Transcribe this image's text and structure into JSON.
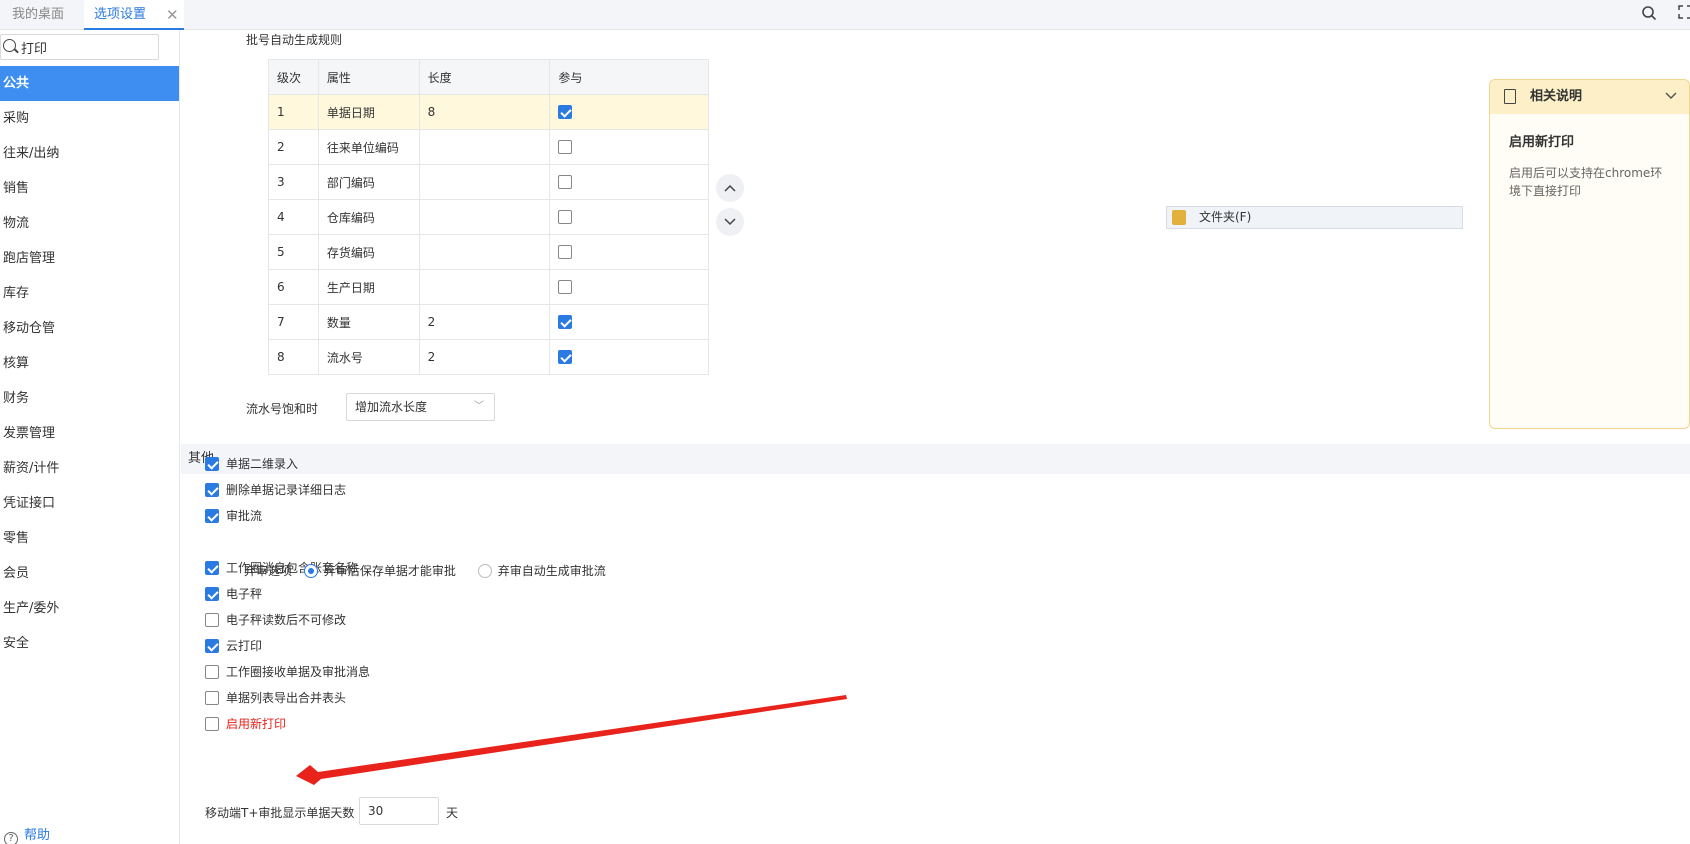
{
  "tabs": {
    "desktop": "我的桌面",
    "options": "选项设置",
    "close": "✕"
  },
  "topbar": {
    "search_icon": "search-icon",
    "fullscreen_icon": "fullscreen-icon"
  },
  "sidebar": {
    "search_value": "打印",
    "items": [
      {
        "label": "公共",
        "active": true
      },
      {
        "label": "采购"
      },
      {
        "label": "往来/出纳"
      },
      {
        "label": "销售"
      },
      {
        "label": "物流"
      },
      {
        "label": "跑店管理"
      },
      {
        "label": "库存"
      },
      {
        "label": "移动仓管"
      },
      {
        "label": "核算"
      },
      {
        "label": "财务"
      },
      {
        "label": "发票管理"
      },
      {
        "label": "薪资/计件"
      },
      {
        "label": "凭证接口"
      },
      {
        "label": "零售"
      },
      {
        "label": "会员"
      },
      {
        "label": "生产/委外"
      },
      {
        "label": "安全"
      }
    ],
    "help": "帮助"
  },
  "batch": {
    "title": "批号自动生成规则",
    "headers": [
      "级次",
      "属性",
      "长度",
      "参与"
    ],
    "rows": [
      {
        "level": "1",
        "attr": "单据日期",
        "length": "8",
        "checked": true
      },
      {
        "level": "2",
        "attr": "往来单位编码",
        "length": "",
        "checked": false
      },
      {
        "level": "3",
        "attr": "部门编码",
        "length": "",
        "checked": false
      },
      {
        "level": "4",
        "attr": "仓库编码",
        "length": "",
        "checked": false
      },
      {
        "level": "5",
        "attr": "存货编码",
        "length": "",
        "checked": false
      },
      {
        "level": "6",
        "attr": "生产日期",
        "length": "",
        "checked": false
      },
      {
        "level": "7",
        "attr": "数量",
        "length": "2",
        "checked": true
      },
      {
        "level": "8",
        "attr": "流水号",
        "length": "2",
        "checked": true
      }
    ],
    "overflow_label": "流水号饱和时",
    "overflow_value": "增加流水长度"
  },
  "folder": {
    "label": "文件夹(F)"
  },
  "info": {
    "header": "相关说明",
    "title": "启用新打印",
    "text": "启用后可以支持在chrome环境下直接打印"
  },
  "other": {
    "title": "其他",
    "options": [
      {
        "label": "单据二维录入",
        "checked": true
      },
      {
        "label": "删除单据记录详细日志",
        "checked": true
      },
      {
        "label": "审批流",
        "checked": true
      },
      {
        "label": "工作圈消息包含账套名称",
        "checked": true
      },
      {
        "label": "电子秤",
        "checked": true
      },
      {
        "label": "电子秤读数后不可修改",
        "checked": false
      },
      {
        "label": "云打印",
        "checked": true
      },
      {
        "label": "工作圈接收单据及审批消息",
        "checked": false
      },
      {
        "label": "单据列表导出合并表头",
        "checked": false
      },
      {
        "label": "启用新打印",
        "checked": false
      }
    ],
    "reject_label": "弃审选项",
    "reject_opt1": "弃审后保存单据才能审批",
    "reject_opt2": "弃审自动生成审批流",
    "days_label": "移动端T+审批显示单据天数",
    "days_value": "30",
    "days_unit": "天"
  },
  "colors": {
    "accent": "#2a7ae2",
    "active_nav": "#3d8ef0",
    "highlight": "#e8231b",
    "info_bg": "#fdf0c8"
  }
}
